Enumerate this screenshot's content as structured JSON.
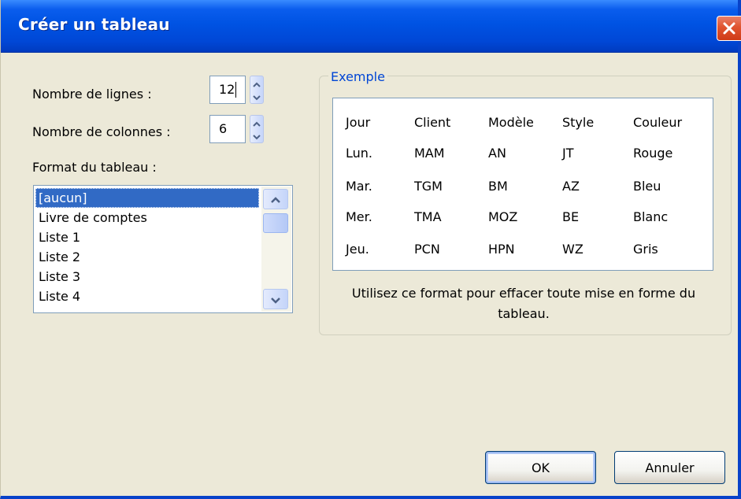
{
  "window": {
    "title": "Créer un tableau"
  },
  "rows_field": {
    "label": "Nombre de lignes :",
    "value": "12"
  },
  "columns_field": {
    "label": "Nombre de colonnes :",
    "value": "6"
  },
  "format": {
    "label": "Format du tableau :",
    "items": [
      "[aucun]",
      "Livre de comptes",
      "Liste 1",
      "Liste 2",
      "Liste 3",
      "Liste 4"
    ],
    "selected_index": 0
  },
  "example": {
    "title": "Exemple",
    "table": [
      [
        "Jour",
        "Client",
        "Modèle",
        "Style",
        "Couleur"
      ],
      [
        "Lun.",
        "MAM",
        "AN",
        "JT",
        "Rouge"
      ],
      [
        "Mar.",
        "TGM",
        "BM",
        "AZ",
        "Bleu"
      ],
      [
        "Mer.",
        "TMA",
        "MOZ",
        "BE",
        "Blanc"
      ],
      [
        "Jeu.",
        "PCN",
        "HPN",
        "WZ",
        "Gris"
      ]
    ],
    "description": "Utilisez ce format pour effacer toute mise en forme du tableau."
  },
  "buttons": {
    "ok": "OK",
    "cancel": "Annuler"
  },
  "icons": {
    "close": "close-icon",
    "spin_up": "chevron-up-icon",
    "spin_down": "chevron-down-icon",
    "scroll_up": "scroll-up-arrow-icon",
    "scroll_down": "scroll-down-arrow-icon"
  },
  "colors": {
    "titlebar": "#0054e3",
    "dialog_background": "#ece9d8",
    "selection": "#316ac5",
    "group_title": "#0046d5",
    "close_button": "#e0542f"
  }
}
